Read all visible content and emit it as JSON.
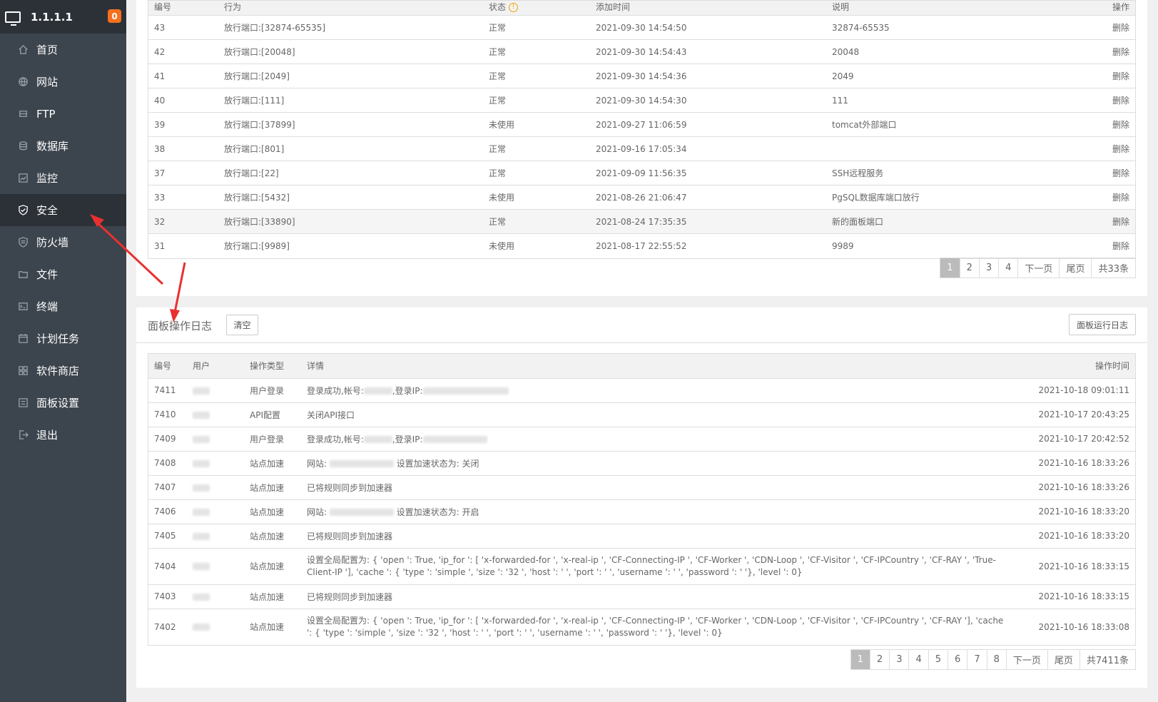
{
  "sidebar": {
    "server_ip": "1.1.1.1",
    "badge_count": "0",
    "items": [
      {
        "label": "首页",
        "icon": "home-icon"
      },
      {
        "label": "网站",
        "icon": "globe-icon"
      },
      {
        "label": "FTP",
        "icon": "ftp-icon"
      },
      {
        "label": "数据库",
        "icon": "database-icon"
      },
      {
        "label": "监控",
        "icon": "monitor-chart-icon"
      },
      {
        "label": "安全",
        "icon": "shield-icon",
        "active": true
      },
      {
        "label": "防火墙",
        "icon": "firewall-shield-icon"
      },
      {
        "label": "文件",
        "icon": "folder-icon"
      },
      {
        "label": "终端",
        "icon": "terminal-icon"
      },
      {
        "label": "计划任务",
        "icon": "calendar-icon"
      },
      {
        "label": "软件商店",
        "icon": "grid-apps-icon"
      },
      {
        "label": "面板设置",
        "icon": "settings-icon"
      },
      {
        "label": "退出",
        "icon": "logout-icon"
      }
    ]
  },
  "rules": {
    "headers": [
      "编号",
      "行为",
      "状态",
      "添加时间",
      "说明",
      "操作"
    ],
    "rows": [
      {
        "id": "43",
        "action": "放行端口:[32874-65535]",
        "status": "正常",
        "time": "2021-09-30 14:54:50",
        "note": "32874-65535",
        "op": "删除"
      },
      {
        "id": "42",
        "action": "放行端口:[20048]",
        "status": "正常",
        "time": "2021-09-30 14:54:43",
        "note": "20048",
        "op": "删除"
      },
      {
        "id": "41",
        "action": "放行端口:[2049]",
        "status": "正常",
        "time": "2021-09-30 14:54:36",
        "note": "2049",
        "op": "删除"
      },
      {
        "id": "40",
        "action": "放行端口:[111]",
        "status": "正常",
        "time": "2021-09-30 14:54:30",
        "note": "111",
        "op": "删除"
      },
      {
        "id": "39",
        "action": "放行端口:[37899]",
        "status": "未使用",
        "time": "2021-09-27 11:06:59",
        "note": "tomcat外部端口",
        "op": "删除"
      },
      {
        "id": "38",
        "action": "放行端口:[801]",
        "status": "正常",
        "time": "2021-09-16 17:05:34",
        "note": "",
        "op": "删除"
      },
      {
        "id": "37",
        "action": "放行端口:[22]",
        "status": "正常",
        "time": "2021-09-09 11:56:35",
        "note": "SSH远程服务",
        "op": "删除"
      },
      {
        "id": "33",
        "action": "放行端口:[5432]",
        "status": "未使用",
        "time": "2021-08-26 21:06:47",
        "note": "PgSQL数据库端口放行",
        "op": "删除"
      },
      {
        "id": "32",
        "action": "放行端口:[33890]",
        "status": "正常",
        "time": "2021-08-24 17:35:35",
        "note": "新的面板端口",
        "op": "删除"
      },
      {
        "id": "31",
        "action": "放行端口:[9989]",
        "status": "未使用",
        "time": "2021-08-17 22:55:52",
        "note": "9989",
        "op": "删除"
      }
    ],
    "pager": {
      "pages": [
        "1",
        "2",
        "3",
        "4"
      ],
      "next": "下一页",
      "last": "尾页",
      "total": "共33条"
    }
  },
  "logs": {
    "title": "面板操作日志",
    "clear_label": "清空",
    "run_log_label": "面板运行日志",
    "headers": [
      "编号",
      "用户",
      "操作类型",
      "详情",
      "操作时间"
    ],
    "rows": [
      {
        "id": "7411",
        "type": "用户登录",
        "detail": "登录成功,帐号:",
        "detail2": ",登录IP:",
        "time": "2021-10-18 09:01:11"
      },
      {
        "id": "7410",
        "type": "API配置",
        "detail": "关闭API接口",
        "detail2": "",
        "time": "2021-10-17 20:43:25"
      },
      {
        "id": "7409",
        "type": "用户登录",
        "detail": "登录成功,帐号:",
        "detail2": ",登录IP:",
        "time": "2021-10-17 20:42:52"
      },
      {
        "id": "7408",
        "type": "站点加速",
        "detail": "网站: ",
        "detail2": " 设置加速状态为: 关闭",
        "time": "2021-10-16 18:33:26"
      },
      {
        "id": "7407",
        "type": "站点加速",
        "detail": "已将规则同步到加速器",
        "detail2": "",
        "time": "2021-10-16 18:33:26"
      },
      {
        "id": "7406",
        "type": "站点加速",
        "detail": "网站: ",
        "detail2": " 设置加速状态为: 开启",
        "time": "2021-10-16 18:33:20"
      },
      {
        "id": "7405",
        "type": "站点加速",
        "detail": "已将规则同步到加速器",
        "detail2": "",
        "time": "2021-10-16 18:33:20"
      },
      {
        "id": "7404",
        "type": "站点加速",
        "detail": "设置全局配置为: { 'open ': True,  'ip_for ': [  'x-forwarded-for ',  'x-real-ip ',  'CF-Connecting-IP ',  'CF-Worker ',  'CDN-Loop ',  'CF-Visitor ',  'CF-IPCountry ',  'CF-RAY ',  'True-Client-IP '],  'cache ': { 'type ':  'simple ',  'size ':  '32 ',  'host ':  ' ',  'port ':  ' ',  'username ':  ' ',  'password ':  ' '},  'level ': 0}",
        "detail2": "",
        "time": "2021-10-16 18:33:15"
      },
      {
        "id": "7403",
        "type": "站点加速",
        "detail": "已将规则同步到加速器",
        "detail2": "",
        "time": "2021-10-16 18:33:15"
      },
      {
        "id": "7402",
        "type": "站点加速",
        "detail": "设置全局配置为: { 'open ': True,  'ip_for ': [  'x-forwarded-for ',  'x-real-ip ',  'CF-Connecting-IP ',  'CF-Worker ',  'CDN-Loop ',  'CF-Visitor ',  'CF-IPCountry ',  'CF-RAY '],  'cache ': { 'type ':  'simple ',  'size ':  '32 ',  'host ':  ' ',  'port ':  ' ',  'username ':  ' ',  'password ':  ' '},  'level ': 0}",
        "detail2": "",
        "time": "2021-10-16 18:33:08"
      }
    ],
    "pager": {
      "pages": [
        "1",
        "2",
        "3",
        "4",
        "5",
        "6",
        "7",
        "8"
      ],
      "next": "下一页",
      "last": "尾页",
      "total": "共7411条"
    }
  },
  "colors": {
    "sidebar_bg": "#3c444d",
    "sidebar_active": "#2c3138",
    "badge": "#f7701d",
    "op_link": "#20a53a",
    "arrow": "#e8312f"
  }
}
